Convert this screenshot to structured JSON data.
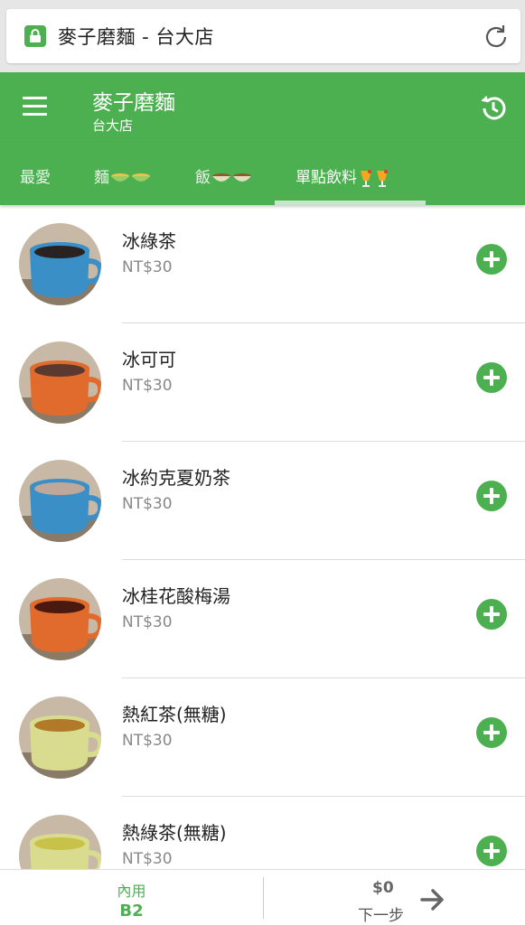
{
  "browser": {
    "url_title": "麥子磨麵 - 台大店"
  },
  "header": {
    "title": "麥子磨麵",
    "subtitle": "台大店"
  },
  "tabs": [
    {
      "label": "最愛",
      "active": false
    },
    {
      "label": "麵",
      "emoji": "bowl-icon",
      "active": false
    },
    {
      "label": "飯",
      "emoji": "bowl-icon",
      "active": false
    },
    {
      "label": "單點飲料",
      "emoji": "drink-icon",
      "active": true
    }
  ],
  "items": [
    {
      "name": "冰綠茶",
      "price": "NT$30",
      "cup": "#3a8fc7",
      "drink": "#2a2220"
    },
    {
      "name": "冰可可",
      "price": "NT$30",
      "cup": "#e06b2c",
      "drink": "#5a3a30"
    },
    {
      "name": "冰約克夏奶茶",
      "price": "NT$30",
      "cup": "#3a8fc7",
      "drink": "#bfa89a"
    },
    {
      "name": "冰桂花酸梅湯",
      "price": "NT$30",
      "cup": "#e06b2c",
      "drink": "#4a1a10"
    },
    {
      "name": "熱紅茶(無糖)",
      "price": "NT$30",
      "cup": "#d9dc8e",
      "drink": "#b07a28"
    },
    {
      "name": "熱綠茶(無糖)",
      "price": "NT$30",
      "cup": "#d9dc8e",
      "drink": "#c9c24a"
    }
  ],
  "bottom": {
    "dine_label": "內用",
    "table": "B2",
    "total": "$0",
    "next_label": "下一步"
  },
  "colors": {
    "primary": "#4caf50",
    "accent_light": "#c8e6c9"
  }
}
